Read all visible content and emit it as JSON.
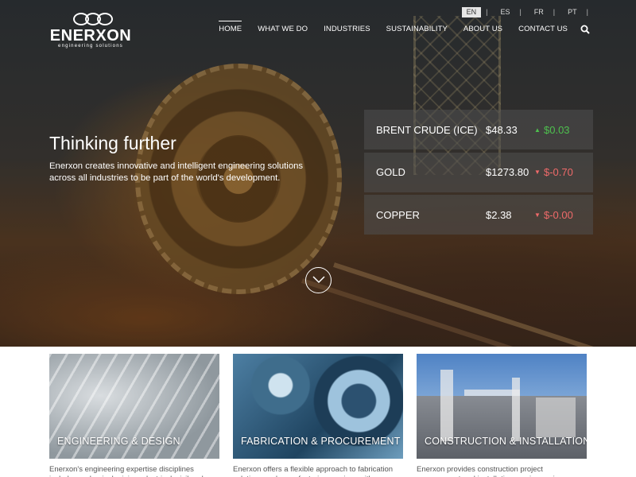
{
  "header": {
    "logo_text": "ENERXON",
    "logo_subtitle": "engineering solutions",
    "languages": [
      {
        "label": "EN",
        "active": true
      },
      {
        "label": "ES",
        "active": false
      },
      {
        "label": "FR",
        "active": false
      },
      {
        "label": "PT",
        "active": false
      }
    ],
    "language_separator": "|",
    "nav": [
      {
        "label": "HOME",
        "active": true
      },
      {
        "label": "WHAT WE DO",
        "active": false
      },
      {
        "label": "INDUSTRIES",
        "active": false
      },
      {
        "label": "SUSTAINABILITY",
        "active": false
      },
      {
        "label": "ABOUT US",
        "active": false
      },
      {
        "label": "CONTACT US",
        "active": false
      }
    ],
    "search_icon": "search-icon"
  },
  "hero": {
    "title": "Thinking further",
    "text": "Enerxon creates innovative and intelligent engineering solutions across all industries to be part of the world's development.",
    "scroll_icon": "chevron-down-icon"
  },
  "ticker": [
    {
      "name": "BRENT CRUDE (ICE)",
      "price": "$48.33",
      "direction": "up",
      "arrow": "▲",
      "change": "$0.03"
    },
    {
      "name": "GOLD",
      "price": "$1273.80",
      "direction": "down",
      "arrow": "▼",
      "change": "$-0.70"
    },
    {
      "name": "COPPER",
      "price": "$2.38",
      "direction": "down",
      "arrow": "▼",
      "change": "$-0.00"
    }
  ],
  "colors": {
    "up": "#4ec04e",
    "down": "#ef6a6a"
  },
  "services": [
    {
      "title": "ENGINEERING & DESIGN",
      "text": "Enerxon's engineering expertise disciplines include mechanical, piping, electrical, civil and structural"
    },
    {
      "title": "FABRICATION & PROCUREMENT",
      "text": "Enerxon offers a flexible approach to fabrication solutions and manufacturing services with a range"
    },
    {
      "title": "CONSTRUCTION & INSTALLATION",
      "text": "Enerxon provides construction project management and installation services using proven technologies"
    }
  ]
}
